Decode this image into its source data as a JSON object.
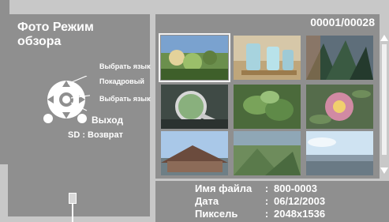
{
  "header": {
    "title": "Фото Режим обзора",
    "counter": "00001/00028"
  },
  "remote": {
    "up_label": "Выбрать язык",
    "center_label": "Покадровый",
    "down_label": "Выбрать язык",
    "exit_label": "Выход",
    "back_label": "SD : Возврат"
  },
  "thumbnails": [
    {
      "name": "thumb-1",
      "scene": "outdoor flowers",
      "selected": true
    },
    {
      "name": "thumb-2",
      "scene": "glasses on table",
      "selected": false
    },
    {
      "name": "thumb-3",
      "scene": "trees and fabric",
      "selected": false
    },
    {
      "name": "thumb-4",
      "scene": "magnifying glass",
      "selected": false
    },
    {
      "name": "thumb-5",
      "scene": "green leaves",
      "selected": false
    },
    {
      "name": "thumb-6",
      "scene": "close-up flower",
      "selected": false
    },
    {
      "name": "thumb-7",
      "scene": "roof under sky",
      "selected": false
    },
    {
      "name": "thumb-8",
      "scene": "grassy field",
      "selected": false
    },
    {
      "name": "thumb-9",
      "scene": "horizon landscape",
      "selected": false
    }
  ],
  "info": {
    "file_key": "Имя файла",
    "file_val": "800-0003",
    "date_key": "Дата",
    "date_val": "06/12/2003",
    "pixel_key": "Пиксель",
    "pixel_val": "2048x1536"
  }
}
